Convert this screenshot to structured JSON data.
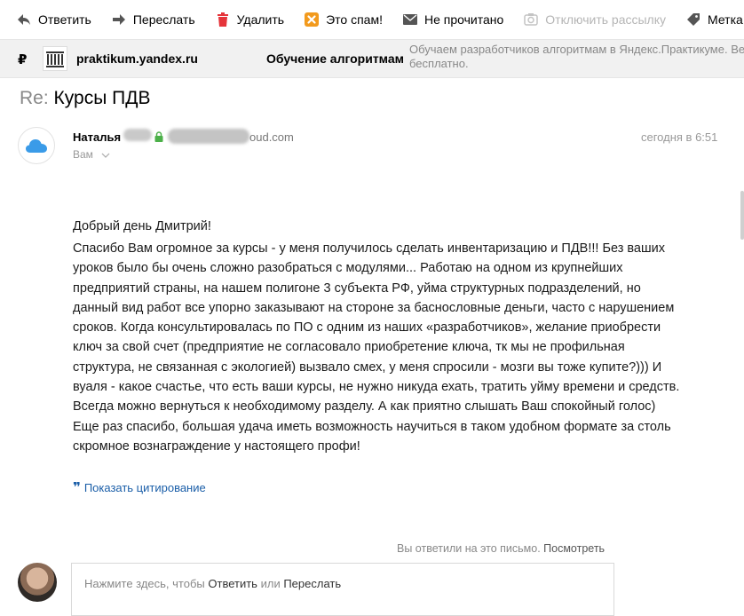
{
  "toolbar": {
    "reply": "Ответить",
    "forward": "Переслать",
    "delete": "Удалить",
    "spam": "Это спам!",
    "unread": "Не прочитано",
    "unsubscribe": "Отключить рассылку",
    "label": "Метка"
  },
  "banner": {
    "currency": "₽",
    "domain": "praktikum.yandex.ru",
    "topic": "Обучение алгоритмам",
    "description": "Обучаем разработчиков алгоритмам в Яндекс.Практикуме. Ве бесплатно."
  },
  "email": {
    "subject_prefix": "Re:",
    "subject": "Курсы ПДВ",
    "sender_name": "Наталья",
    "sender_email_tail": "oud.com",
    "recipient": "Вам",
    "date": "сегодня в 6:51",
    "greeting": "Добрый день Дмитрий!",
    "lines": [
      "Спасибо Вам огромное за курсы - у меня получилось сделать инвентаризацию и ПДВ!!! Без ваших",
      "уроков было бы очень сложно разобраться с модулями... Работаю на одном из крупнейших",
      "предприятий страны, на нашем полигоне 3 субъекта РФ, уйма структурных подразделений, но",
      "данный вид работ все упорно заказывают на стороне за басносл овные деньги, часто с нарушением",
      "сроков. Когда консультировалась по ПО с одним из наших «разработчиков», желание приобрести",
      "ключ за свой счет (предприятие не согласовало приобретение ключа, тк мы не профильная",
      "структура, не связанная с экологией) вызвало смех, у меня спросили - мозги вы тоже купите?))) И",
      "вуаля - какое счастье, что есть ваши курсы, не нужно никуда ехать, тратить уйму времени и средств.",
      "Всегда можно вернуться к необходимому разделу. А как приятно слышать Ваш спокойный голос)",
      "Еще раз спасибо, большая удача иметь возможность научиться в таком удобном формате за столь",
      "скромное вознаграждение у настоящего профи!"
    ],
    "show_quote": "Показать цитирование"
  },
  "reply": {
    "status": "Вы ответили на это письмо.",
    "view": "Посмотреть",
    "hint_prefix": "Нажмите здесь, чтобы",
    "hint_reply": "Ответить",
    "hint_or": "или",
    "hint_forward": "Переслать"
  },
  "icons": {
    "reply": "reply-arrow-icon",
    "forward": "forward-arrow-icon",
    "delete": "trash-icon",
    "spam": "spam-icon",
    "unread": "envelope-icon",
    "unsubscribe": "unsubscribe-icon",
    "label": "tag-icon",
    "sender": "icloud-icon",
    "secure": "lock-icon"
  },
  "colors": {
    "delete": "#e5343a",
    "spam": "#f29a1d",
    "secure": "#4cb049",
    "link": "#1a5ea8",
    "cloud": "#3a9be8"
  }
}
